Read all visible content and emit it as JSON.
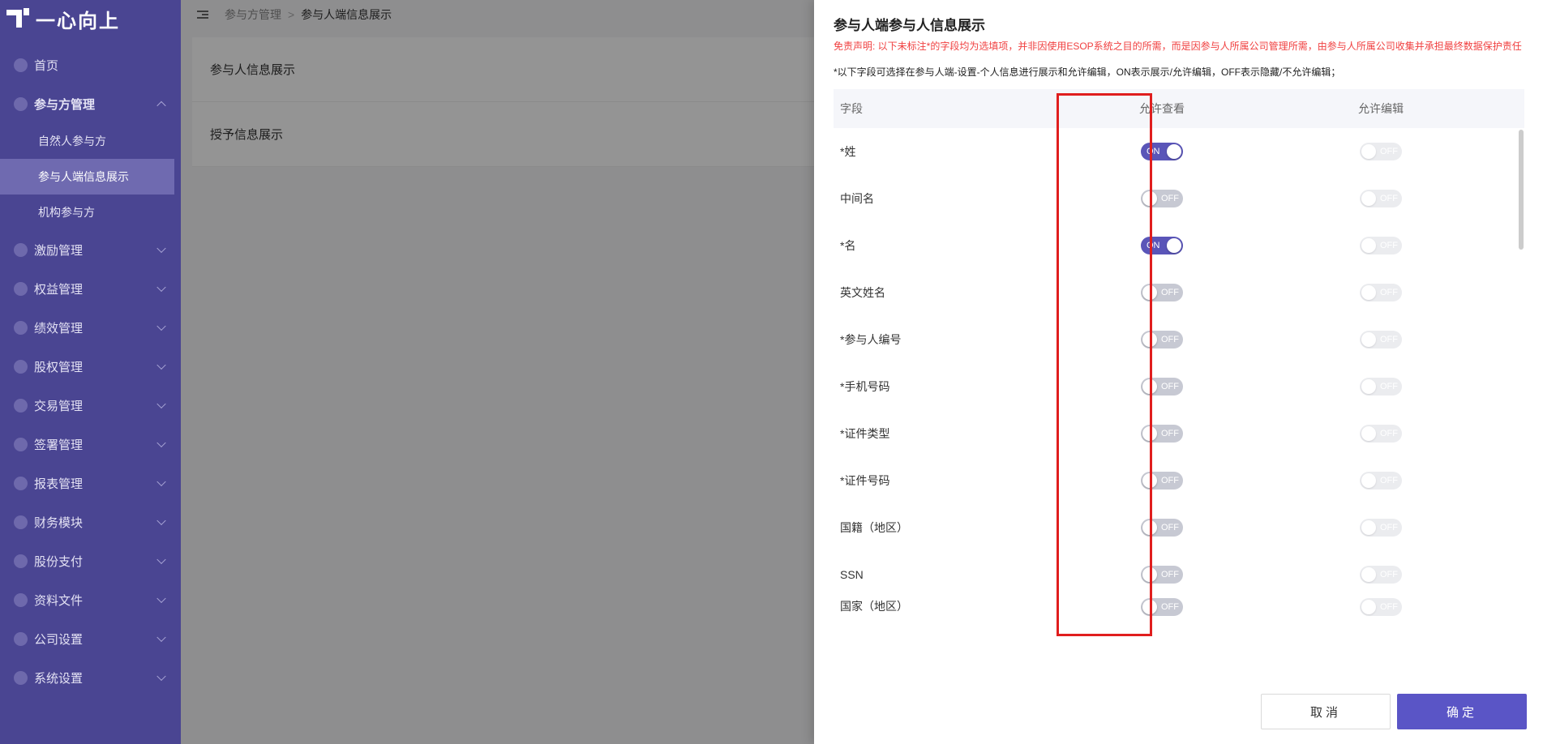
{
  "app": {
    "logo_text": "一心向上"
  },
  "sidebar": {
    "items": [
      {
        "label": "首页",
        "icon": "home-icon"
      },
      {
        "label": "参与方管理",
        "icon": "participants-icon",
        "open": true,
        "children": [
          {
            "label": "自然人参与方"
          },
          {
            "label": "参与人端信息展示",
            "active": true
          },
          {
            "label": "机构参与方"
          }
        ]
      },
      {
        "label": "激励管理",
        "icon": "incentive-icon"
      },
      {
        "label": "权益管理",
        "icon": "equity-rights-icon"
      },
      {
        "label": "绩效管理",
        "icon": "performance-icon"
      },
      {
        "label": "股权管理",
        "icon": "stock-icon"
      },
      {
        "label": "交易管理",
        "icon": "transaction-icon"
      },
      {
        "label": "签署管理",
        "icon": "signing-icon"
      },
      {
        "label": "报表管理",
        "icon": "report-icon"
      },
      {
        "label": "财务模块",
        "icon": "finance-icon"
      },
      {
        "label": "股份支付",
        "icon": "share-payment-icon"
      },
      {
        "label": "资料文件",
        "icon": "documents-icon"
      },
      {
        "label": "公司设置",
        "icon": "company-settings-icon"
      },
      {
        "label": "系统设置",
        "icon": "system-settings-icon"
      }
    ]
  },
  "breadcrumb": {
    "parent": "参与方管理",
    "current": "参与人端信息展示"
  },
  "page": {
    "rows": [
      "参与人信息展示",
      "授予信息展示"
    ]
  },
  "drawer": {
    "title": "参与人端参与人信息展示",
    "disclaimer": "免责声明: 以下未标注*的字段均为选填项，并非因使用ESOP系统之目的所需，而是因参与人所属公司管理所需，由参与人所属公司收集并承担最终数据保护责任",
    "notice": "*以下字段可选择在参与人端-设置-个人信息进行展示和允许编辑，ON表示展示/允许编辑，OFF表示隐藏/不允许编辑；",
    "columns": {
      "field": "字段",
      "view": "允许查看",
      "edit": "允许编辑"
    },
    "rows": [
      {
        "field": "*姓",
        "view": "ON",
        "edit": "OFF"
      },
      {
        "field": "中间名",
        "view": "OFF",
        "edit": "OFF"
      },
      {
        "field": "*名",
        "view": "ON",
        "edit": "OFF"
      },
      {
        "field": "英文姓名",
        "view": "OFF",
        "edit": "OFF"
      },
      {
        "field": "*参与人编号",
        "view": "OFF",
        "edit": "OFF"
      },
      {
        "field": "*手机号码",
        "view": "OFF",
        "edit": "OFF"
      },
      {
        "field": "*证件类型",
        "view": "OFF",
        "edit": "OFF"
      },
      {
        "field": "*证件号码",
        "view": "OFF",
        "edit": "OFF"
      },
      {
        "field": "国籍（地区）",
        "view": "OFF",
        "edit": "OFF"
      },
      {
        "field": "SSN",
        "view": "OFF",
        "edit": "OFF"
      },
      {
        "field": "国家（地区）",
        "view": "OFF",
        "edit": "OFF"
      }
    ],
    "cancel_label": "取消",
    "ok_label": "确定"
  },
  "colors": {
    "sidebar": "#4a4592",
    "accent": "#5a55c6",
    "switch_on": "#5a55b8",
    "highlight": "#e01e1e",
    "disclaimer": "#f04040"
  }
}
